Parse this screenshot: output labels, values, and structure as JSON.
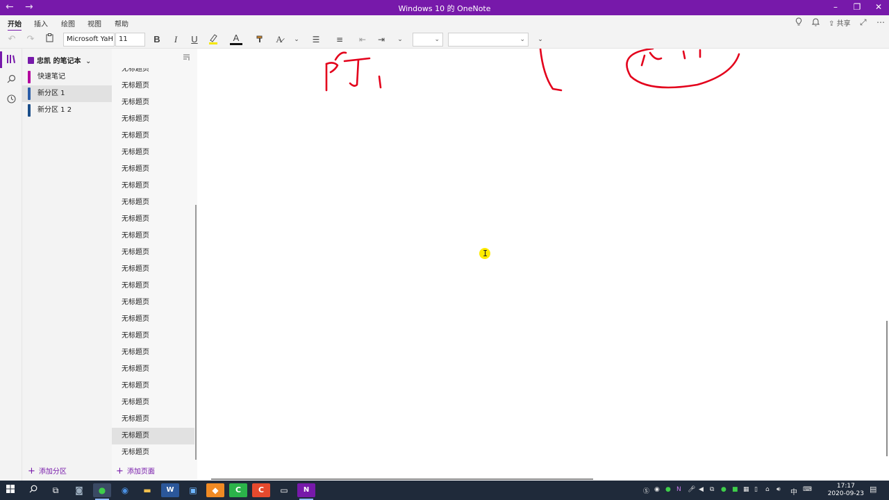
{
  "window": {
    "title": "Windows 10 的 OneNote",
    "back_icon": "←",
    "forward_icon": "→",
    "minimize_icon": "–",
    "restore_icon": "❐",
    "close_icon": "✕"
  },
  "menu": {
    "tabs": [
      "开始",
      "插入",
      "绘图",
      "视图",
      "帮助"
    ],
    "share_label": "共享"
  },
  "toolbar": {
    "font_name": "Microsoft YaH",
    "font_size": "11",
    "bold": "B",
    "italic": "I",
    "underline": "U",
    "font_color": "A",
    "style_value": "",
    "style2_value": ""
  },
  "notebook": {
    "name": "忠凯 的笔记本",
    "sections": [
      {
        "label": "快速笔记",
        "color": "#b4009e",
        "selected": false
      },
      {
        "label": "新分区 1",
        "color": "#2a5da8",
        "selected": true
      },
      {
        "label": "新分区 1 2",
        "color": "#1c4f8a",
        "selected": false
      }
    ],
    "add_section_label": "添加分区"
  },
  "pages": {
    "items": [
      "无标题页",
      "无标题页",
      "无标题页",
      "无标题页",
      "无标题页",
      "无标题页",
      "无标题页",
      "无标题页",
      "无标题页",
      "无标题页",
      "无标题页",
      "无标题页",
      "无标题页",
      "无标题页",
      "无标题页",
      "无标题页",
      "无标题页",
      "无标题页",
      "无标题页",
      "无标题页",
      "无标题页",
      "无标题页",
      "无标题页",
      "无标题页"
    ],
    "selected_index": 22,
    "add_page_label": "添加页面"
  },
  "canvas": {
    "ink_color": "#e3001b",
    "cursor_color": "#ffeb00"
  },
  "taskbar": {
    "clock_time": "17:17",
    "clock_date": "2020-09-23",
    "ime_label": "中"
  },
  "colors": {
    "accent": "#7719aa"
  }
}
